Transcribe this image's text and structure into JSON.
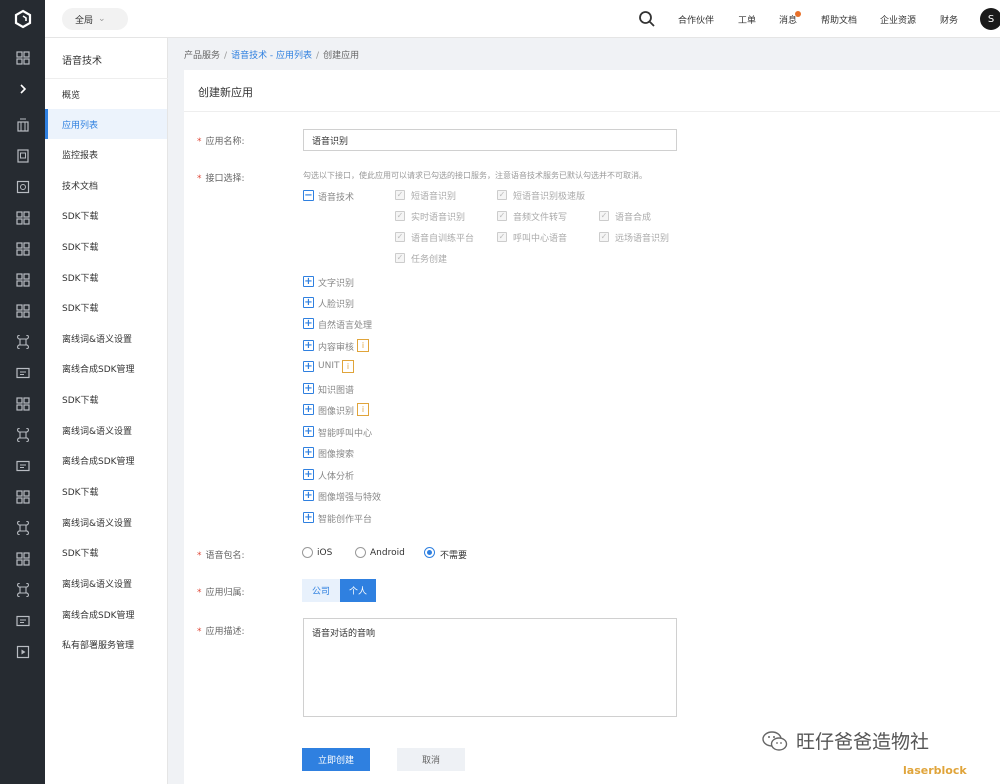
{
  "topbar": {
    "region": "全局",
    "nav": [
      "合作伙伴",
      "工单",
      "消息",
      "帮助文档",
      "企业资源",
      "财务"
    ],
    "avatar": "S"
  },
  "sidebar": {
    "title": "语音技术",
    "items": [
      {
        "label": "概览",
        "active": false
      },
      {
        "label": "应用列表",
        "active": true
      },
      {
        "label": "监控报表",
        "active": false
      },
      {
        "label": "技术文档",
        "active": false
      },
      {
        "label": "SDK下载",
        "active": false
      },
      {
        "label": "SDK下载",
        "active": false
      },
      {
        "label": "SDK下载",
        "active": false
      },
      {
        "label": "SDK下载",
        "active": false
      },
      {
        "label": "离线词&语义设置",
        "active": false
      },
      {
        "label": "离线合成SDK管理",
        "active": false
      },
      {
        "label": "SDK下载",
        "active": false
      },
      {
        "label": "离线词&语义设置",
        "active": false
      },
      {
        "label": "离线合成SDK管理",
        "active": false
      },
      {
        "label": "SDK下载",
        "active": false
      },
      {
        "label": "离线词&语义设置",
        "active": false
      },
      {
        "label": "SDK下载",
        "active": false
      },
      {
        "label": "离线词&语义设置",
        "active": false
      },
      {
        "label": "离线合成SDK管理",
        "active": false
      },
      {
        "label": "私有部署服务管理",
        "active": false
      }
    ]
  },
  "breadcrumb": {
    "root": "产品服务",
    "link": "语音技术 - 应用列表",
    "current": "创建应用",
    "separator": "/"
  },
  "page": {
    "title": "创建新应用"
  },
  "form": {
    "app_name_label": "应用名称:",
    "app_name_value": "语音识别",
    "api_label": "接口选择:",
    "api_hint": "勾选以下接口，使此应用可以请求已勾选的接口服务，注意语音技术服务已默认勾选并不可取消。",
    "speech_group": {
      "label": "语音技术",
      "items": [
        "短语音识别",
        "短语音识别极速版",
        "实时语音识别",
        "音频文件转写",
        "语音合成",
        "语音自训练平台",
        "呼叫中心语音",
        "远场语音识别",
        "任务创建"
      ]
    },
    "other_groups": [
      "文字识别",
      "人脸识别",
      "自然语言处理",
      "内容审核",
      "UNIT",
      "知识图谱",
      "图像识别",
      "智能呼叫中心",
      "图像搜索",
      "人体分析",
      "图像增强与特效",
      "智能创作平台"
    ],
    "info_badge": "i",
    "package_label": "语音包名:",
    "package_options": [
      "iOS",
      "Android",
      "不需要"
    ],
    "package_selected": "不需要",
    "ownership_label": "应用归属:",
    "ownership_options": [
      "公司",
      "个人"
    ],
    "ownership_selected": "个人",
    "desc_label": "应用描述:",
    "desc_value": "语音对话的音响",
    "create_button": "立即创建",
    "cancel_button": "取消"
  },
  "watermark": {
    "text": "旺仔爸爸造物社",
    "stamp": "laserblock"
  }
}
